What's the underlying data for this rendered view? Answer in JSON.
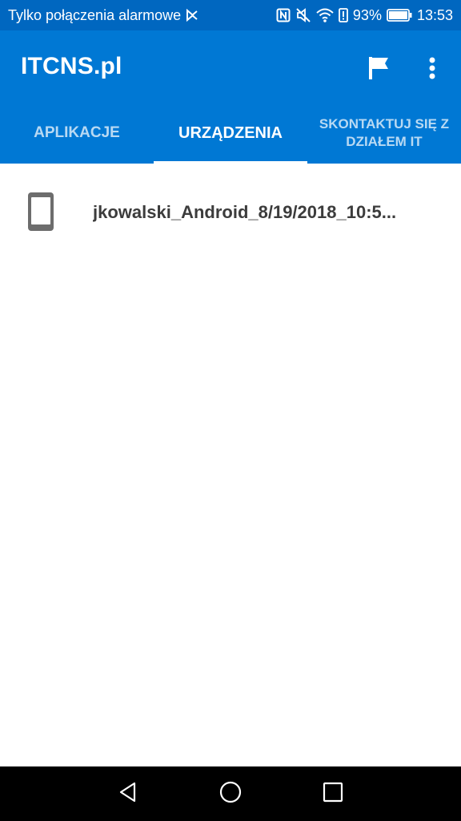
{
  "status_bar": {
    "carrier_text": "Tylko połączenia alarmowe",
    "battery_percent": "93%",
    "time": "13:53",
    "icons": [
      "vpn-key-icon",
      "nfc-icon",
      "mute-icon",
      "wifi-icon",
      "battery-alert-icon",
      "battery-icon"
    ]
  },
  "app_bar": {
    "title": "ITCNS.pl",
    "actions": [
      "flag-icon",
      "more-vert-icon"
    ],
    "color": "#0078d4"
  },
  "tabs": [
    {
      "label": "APLIKACJE",
      "active": false
    },
    {
      "label": "URZĄDZENIA",
      "active": true
    },
    {
      "label": "SKONTAKTUJ SIĘ Z DZIAŁEM IT",
      "active": false
    }
  ],
  "devices": [
    {
      "name": "jkowalski_Android_8/19/2018_10:5...",
      "icon": "phone-icon"
    }
  ],
  "nav_bar": {
    "buttons": [
      "back-icon",
      "home-icon",
      "recents-icon"
    ]
  }
}
